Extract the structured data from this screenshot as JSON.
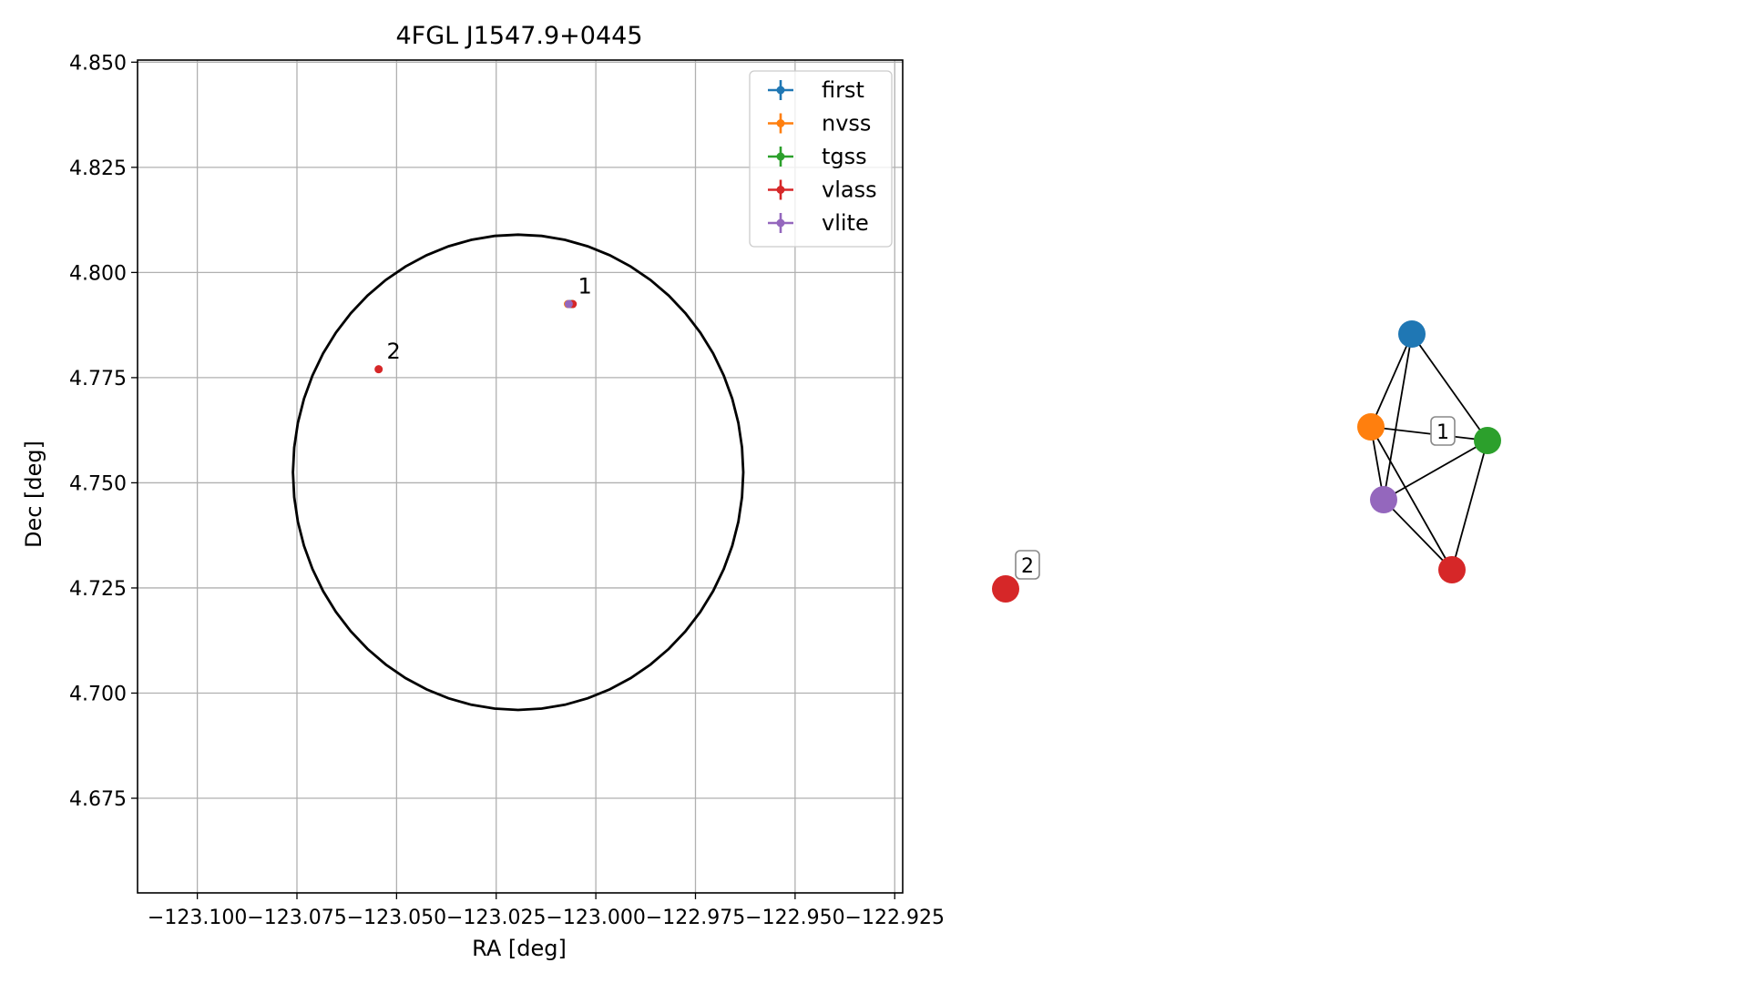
{
  "chart_data": [
    {
      "type": "scatter",
      "title": "4FGL J1547.9+0445",
      "xlabel": "RA [deg]",
      "ylabel": "Dec [deg]",
      "xlim": [
        -123.115,
        -122.923
      ],
      "ylim": [
        4.6525,
        4.8505
      ],
      "x_tick_values": [
        -123.1,
        -123.075,
        -123.05,
        -123.025,
        -123.0,
        -122.975,
        -122.95,
        -122.925
      ],
      "x_tick_labels": [
        "−123.100",
        "−123.075",
        "−123.050",
        "−123.025",
        "−123.000",
        "−122.975",
        "−122.950",
        "−122.925"
      ],
      "y_tick_values": [
        4.675,
        4.7,
        4.725,
        4.75,
        4.775,
        4.8,
        4.825,
        4.85
      ],
      "y_tick_labels": [
        "4.675",
        "4.700",
        "4.725",
        "4.750",
        "4.775",
        "4.800",
        "4.825",
        "4.850"
      ],
      "grid": true,
      "legend_position": "top-right",
      "series": [
        {
          "name": "first",
          "color": "#1f77b4",
          "x": [
            -123.0065
          ],
          "y": [
            4.7925
          ]
        },
        {
          "name": "nvss",
          "color": "#ff7f0e",
          "x": [
            -123.007
          ],
          "y": [
            4.7925
          ]
        },
        {
          "name": "tgss",
          "color": "#2ca02c",
          "x": [
            -123.006
          ],
          "y": [
            4.7925
          ]
        },
        {
          "name": "vlass",
          "color": "#d62728",
          "x": [
            -123.0058,
            -123.0545
          ],
          "y": [
            4.7925,
            4.777
          ]
        },
        {
          "name": "vlite",
          "color": "#9467bd",
          "x": [
            -123.0068
          ],
          "y": [
            4.7925
          ]
        }
      ],
      "annotations": [
        {
          "text": "1",
          "x": -123.0045,
          "y": 4.795
        },
        {
          "text": "2",
          "x": -123.0525,
          "y": 4.7795
        }
      ],
      "circle": {
        "center_ra": -123.0195,
        "center_dec": 4.7525,
        "radius_deg": 0.0565,
        "color": "#000000"
      }
    },
    {
      "type": "network",
      "nodes": [
        {
          "id": "first",
          "color": "#1f77b4",
          "group": "1"
        },
        {
          "id": "nvss",
          "color": "#ff7f0e",
          "group": "1"
        },
        {
          "id": "tgss",
          "color": "#2ca02c",
          "group": "1"
        },
        {
          "id": "vlite",
          "color": "#9467bd",
          "group": "1"
        },
        {
          "id": "vlass",
          "color": "#d62728",
          "group": "1"
        },
        {
          "id": "vlass",
          "color": "#d62728",
          "group": "2"
        }
      ],
      "edges": [
        [
          "first",
          "nvss"
        ],
        [
          "first",
          "tgss"
        ],
        [
          "first",
          "vlite"
        ],
        [
          "nvss",
          "tgss"
        ],
        [
          "nvss",
          "vlite"
        ],
        [
          "nvss",
          "vlass"
        ],
        [
          "tgss",
          "vlite"
        ],
        [
          "tgss",
          "vlass"
        ],
        [
          "vlite",
          "vlass"
        ]
      ],
      "group_labels": [
        "1",
        "2"
      ]
    }
  ]
}
